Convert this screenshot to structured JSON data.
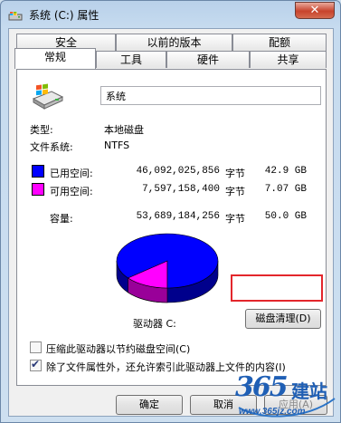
{
  "window": {
    "title": "系统 (C:) 属性",
    "close_glyph": "✕"
  },
  "tabs": {
    "row1": [
      "安全",
      "以前的版本",
      "配额"
    ],
    "row2": [
      "常规",
      "工具",
      "硬件",
      "共享"
    ],
    "active": "常规"
  },
  "general": {
    "drive_name": "系统",
    "type_label": "类型:",
    "type_value": "本地磁盘",
    "fs_label": "文件系统:",
    "fs_value": "NTFS",
    "used": {
      "label": "已用空间:",
      "bytes": "46,092,025,856",
      "unit": "字节",
      "size": "42.9 GB",
      "color": "#0000ff"
    },
    "free": {
      "label": "可用空间:",
      "bytes": "7,597,158,400",
      "unit": "字节",
      "size": "7.07 GB",
      "color": "#ff00ff"
    },
    "capacity": {
      "label": "容量:",
      "bytes": "53,689,184,256",
      "unit": "字节",
      "size": "50.0 GB"
    },
    "drive_label": "驱动器 C:",
    "cleanup_button": "磁盘清理(D)",
    "compress_label": "压缩此驱动器以节约磁盘空间(C)",
    "compress_checked": false,
    "index_label": "除了文件属性外，还允许索引此驱动器上文件的内容(I)",
    "index_checked": true
  },
  "buttons": {
    "ok": "确定",
    "cancel": "取消",
    "apply": "应用(A)"
  },
  "watermark": {
    "brand_number": "365",
    "brand_text": "建站",
    "url": "www.365jz.com"
  },
  "chart_data": {
    "type": "pie",
    "categories": [
      "已用空间",
      "可用空间"
    ],
    "values": [
      42.9,
      7.07
    ],
    "colors": [
      "#0000ff",
      "#ff00ff"
    ]
  }
}
